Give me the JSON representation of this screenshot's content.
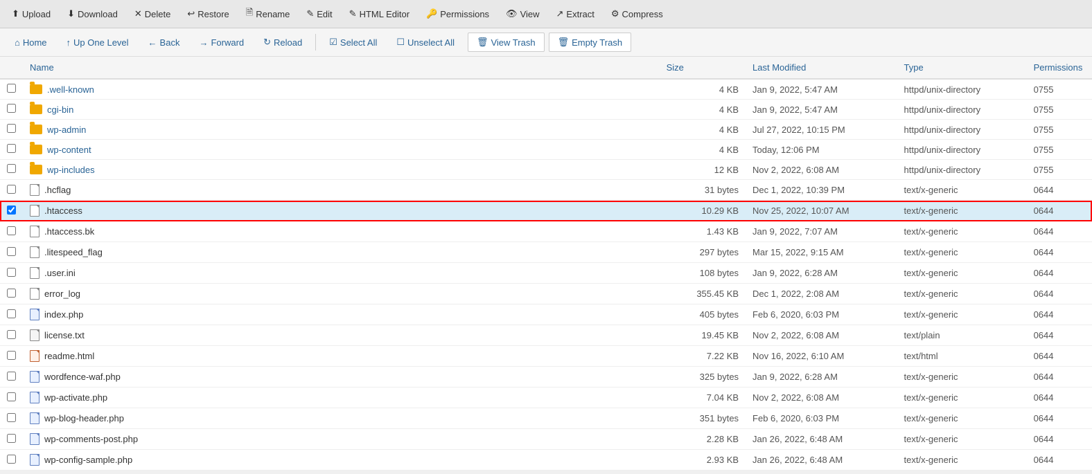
{
  "toolbar": {
    "buttons": [
      {
        "id": "upload",
        "label": "Upload",
        "icon": "⬆"
      },
      {
        "id": "download",
        "label": "Download",
        "icon": "⬇"
      },
      {
        "id": "delete",
        "label": "Delete",
        "icon": "✕"
      },
      {
        "id": "restore",
        "label": "Restore",
        "icon": "↩"
      },
      {
        "id": "rename",
        "label": "Rename",
        "icon": "🗎"
      },
      {
        "id": "edit",
        "label": "Edit",
        "icon": "✎"
      },
      {
        "id": "html-editor",
        "label": "HTML Editor",
        "icon": "✎"
      },
      {
        "id": "permissions",
        "label": "Permissions",
        "icon": "🔑"
      },
      {
        "id": "view",
        "label": "View",
        "icon": "👁"
      },
      {
        "id": "extract",
        "label": "Extract",
        "icon": "↗"
      },
      {
        "id": "compress",
        "label": "Compress",
        "icon": "⚙"
      }
    ]
  },
  "navbar": {
    "buttons": [
      {
        "id": "home",
        "label": "Home",
        "icon": "⌂"
      },
      {
        "id": "up-one-level",
        "label": "Up One Level",
        "icon": "↑"
      },
      {
        "id": "back",
        "label": "Back",
        "icon": "←"
      },
      {
        "id": "forward",
        "label": "Forward",
        "icon": "→"
      },
      {
        "id": "reload",
        "label": "Reload",
        "icon": "↻"
      },
      {
        "id": "select-all",
        "label": "Select All",
        "icon": "☑"
      },
      {
        "id": "unselect-all",
        "label": "Unselect All",
        "icon": "☐"
      },
      {
        "id": "view-trash",
        "label": "View Trash",
        "icon": "🗑"
      },
      {
        "id": "empty-trash",
        "label": "Empty Trash",
        "icon": "🗑"
      }
    ]
  },
  "table": {
    "headers": {
      "name": "Name",
      "size": "Size",
      "last_modified": "Last Modified",
      "type": "Type",
      "permissions": "Permissions"
    },
    "files": [
      {
        "name": ".well-known",
        "size": "4 KB",
        "modified": "Jan 9, 2022, 5:47 AM",
        "type": "httpd/unix-directory",
        "perms": "0755",
        "kind": "folder",
        "selected": false
      },
      {
        "name": "cgi-bin",
        "size": "4 KB",
        "modified": "Jan 9, 2022, 5:47 AM",
        "type": "httpd/unix-directory",
        "perms": "0755",
        "kind": "folder",
        "selected": false
      },
      {
        "name": "wp-admin",
        "size": "4 KB",
        "modified": "Jul 27, 2022, 10:15 PM",
        "type": "httpd/unix-directory",
        "perms": "0755",
        "kind": "folder",
        "selected": false
      },
      {
        "name": "wp-content",
        "size": "4 KB",
        "modified": "Today, 12:06 PM",
        "type": "httpd/unix-directory",
        "perms": "0755",
        "kind": "folder",
        "selected": false
      },
      {
        "name": "wp-includes",
        "size": "12 KB",
        "modified": "Nov 2, 2022, 6:08 AM",
        "type": "httpd/unix-directory",
        "perms": "0755",
        "kind": "folder",
        "selected": false
      },
      {
        "name": ".hcflag",
        "size": "31 bytes",
        "modified": "Dec 1, 2022, 10:39 PM",
        "type": "text/x-generic",
        "perms": "0644",
        "kind": "file",
        "selected": false
      },
      {
        "name": ".htaccess",
        "size": "10.29 KB",
        "modified": "Nov 25, 2022, 10:07 AM",
        "type": "text/x-generic",
        "perms": "0644",
        "kind": "file",
        "selected": true
      },
      {
        "name": ".htaccess.bk",
        "size": "1.43 KB",
        "modified": "Jan 9, 2022, 7:07 AM",
        "type": "text/x-generic",
        "perms": "0644",
        "kind": "file",
        "selected": false
      },
      {
        "name": ".litespeed_flag",
        "size": "297 bytes",
        "modified": "Mar 15, 2022, 9:15 AM",
        "type": "text/x-generic",
        "perms": "0644",
        "kind": "file",
        "selected": false
      },
      {
        "name": ".user.ini",
        "size": "108 bytes",
        "modified": "Jan 9, 2022, 6:28 AM",
        "type": "text/x-generic",
        "perms": "0644",
        "kind": "file",
        "selected": false
      },
      {
        "name": "error_log",
        "size": "355.45 KB",
        "modified": "Dec 1, 2022, 2:08 AM",
        "type": "text/x-generic",
        "perms": "0644",
        "kind": "file",
        "selected": false
      },
      {
        "name": "index.php",
        "size": "405 bytes",
        "modified": "Feb 6, 2020, 6:03 PM",
        "type": "text/x-generic",
        "perms": "0644",
        "kind": "file-php",
        "selected": false
      },
      {
        "name": "license.txt",
        "size": "19.45 KB",
        "modified": "Nov 2, 2022, 6:08 AM",
        "type": "text/plain",
        "perms": "0644",
        "kind": "file-txt",
        "selected": false
      },
      {
        "name": "readme.html",
        "size": "7.22 KB",
        "modified": "Nov 16, 2022, 6:10 AM",
        "type": "text/html",
        "perms": "0644",
        "kind": "file-html",
        "selected": false
      },
      {
        "name": "wordfence-waf.php",
        "size": "325 bytes",
        "modified": "Jan 9, 2022, 6:28 AM",
        "type": "text/x-generic",
        "perms": "0644",
        "kind": "file-php",
        "selected": false
      },
      {
        "name": "wp-activate.php",
        "size": "7.04 KB",
        "modified": "Nov 2, 2022, 6:08 AM",
        "type": "text/x-generic",
        "perms": "0644",
        "kind": "file-php",
        "selected": false
      },
      {
        "name": "wp-blog-header.php",
        "size": "351 bytes",
        "modified": "Feb 6, 2020, 6:03 PM",
        "type": "text/x-generic",
        "perms": "0644",
        "kind": "file-php",
        "selected": false
      },
      {
        "name": "wp-comments-post.php",
        "size": "2.28 KB",
        "modified": "Jan 26, 2022, 6:48 AM",
        "type": "text/x-generic",
        "perms": "0644",
        "kind": "file-php",
        "selected": false
      },
      {
        "name": "wp-config-sample.php",
        "size": "2.93 KB",
        "modified": "Jan 26, 2022, 6:48 AM",
        "type": "text/x-generic",
        "perms": "0644",
        "kind": "file-php",
        "selected": false
      }
    ]
  }
}
